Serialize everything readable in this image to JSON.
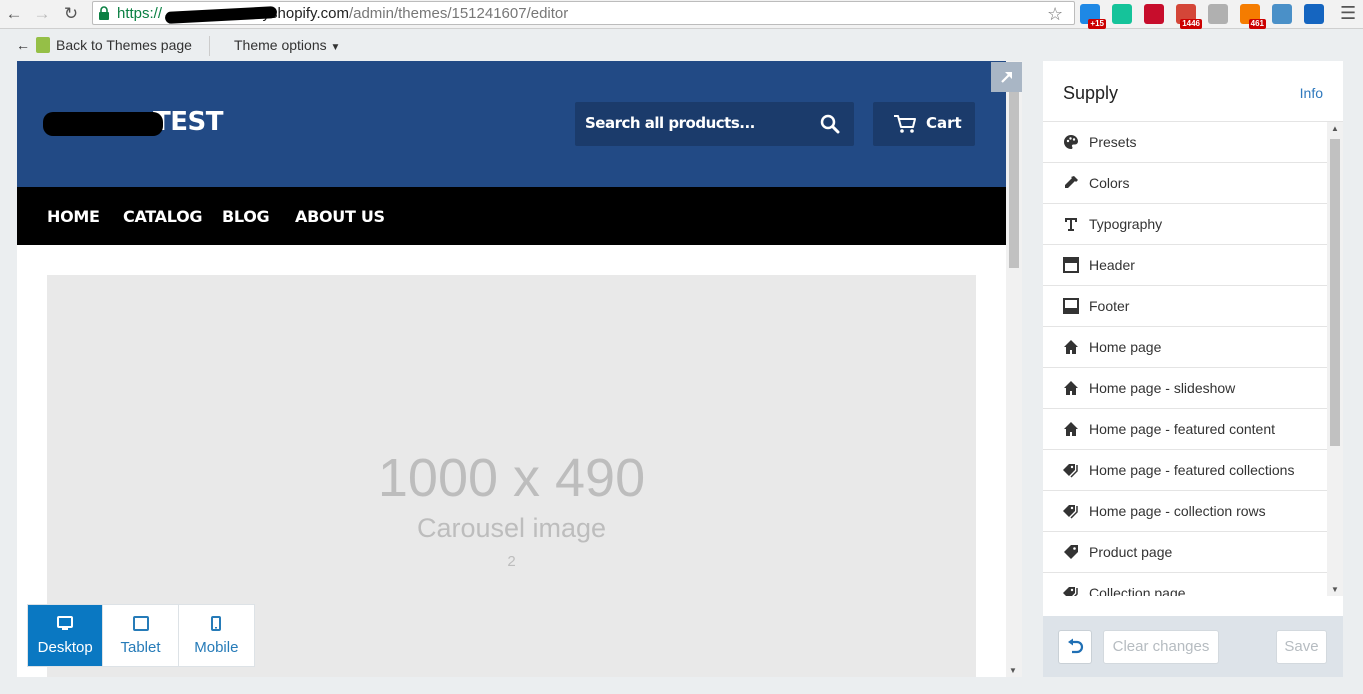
{
  "browser": {
    "url_protocol": "https://",
    "url_host": "myshopify.com",
    "url_path": "/admin/themes/151241607/editor",
    "extensions": [
      {
        "name": "messenger-extension",
        "color": "#1e88e5",
        "badge": "+15"
      },
      {
        "name": "grammarly-extension",
        "color": "#15c39a",
        "badge": ""
      },
      {
        "name": "adblock-plus-extension",
        "color": "#c70d2c",
        "badge": ""
      },
      {
        "name": "gmail-checker-extension",
        "color": "#d44638",
        "badge": "1446"
      },
      {
        "name": "generic-extension",
        "color": "#b0b0b0",
        "badge": ""
      },
      {
        "name": "rss-feed-extension",
        "color": "#f57c00",
        "badge": "461"
      },
      {
        "name": "fst-extension",
        "color": "#4a90c8",
        "badge": ""
      },
      {
        "name": "window-extension",
        "color": "#1565c0",
        "badge": ""
      }
    ]
  },
  "topbar": {
    "back_label": "Back to Themes page",
    "theme_options_label": "Theme options"
  },
  "store": {
    "logo_text": "TEST",
    "search_placeholder": "Search all products...",
    "cart_label": "Cart",
    "nav": [
      "HOME",
      "CATALOG",
      "BLOG",
      "ABOUT US"
    ],
    "header_color": "#224a85",
    "carousel": {
      "size_text": "1000 x 490",
      "label": "Carousel image",
      "index": "2"
    }
  },
  "devices": [
    {
      "label": "Desktop",
      "active": true
    },
    {
      "label": "Tablet",
      "active": false
    },
    {
      "label": "Mobile",
      "active": false
    }
  ],
  "sidebar": {
    "title": "Supply",
    "info_label": "Info",
    "items": [
      {
        "label": "Presets",
        "icon": "palette-icon"
      },
      {
        "label": "Colors",
        "icon": "eyedropper-icon"
      },
      {
        "label": "Typography",
        "icon": "text-icon"
      },
      {
        "label": "Header",
        "icon": "header-layout-icon"
      },
      {
        "label": "Footer",
        "icon": "footer-layout-icon"
      },
      {
        "label": "Home page",
        "icon": "home-icon"
      },
      {
        "label": "Home page - slideshow",
        "icon": "home-icon"
      },
      {
        "label": "Home page - featured content",
        "icon": "home-icon"
      },
      {
        "label": "Home page - featured collections",
        "icon": "tags-icon"
      },
      {
        "label": "Home page - collection rows",
        "icon": "tags-icon"
      },
      {
        "label": "Product page",
        "icon": "tag-icon"
      },
      {
        "label": "Collection page",
        "icon": "tags-icon"
      }
    ],
    "clear_label": "Clear changes",
    "save_label": "Save"
  }
}
